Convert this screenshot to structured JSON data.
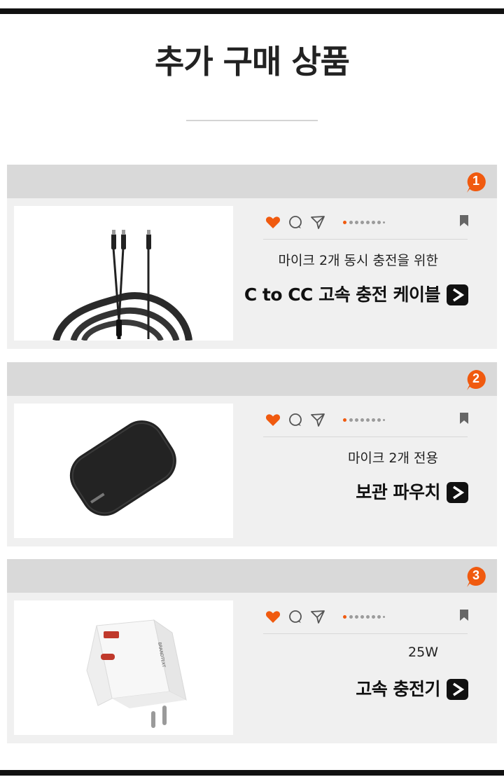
{
  "page": {
    "title": "추가 구매 상품"
  },
  "colors": {
    "accent": "#f05a0f",
    "dark": "#111111",
    "card_bg": "#f0f0f0",
    "header_bg": "#d9d9d9"
  },
  "products": [
    {
      "number": "1",
      "subtitle": "마이크 2개 동시 충전을 위한",
      "name": "C to CC 고속 충전 케이블",
      "go_label": ">",
      "image": "cable-image"
    },
    {
      "number": "2",
      "subtitle": "마이크 2개 전용",
      "name": "보관 파우치",
      "go_label": ">",
      "image": "pouch-image"
    },
    {
      "number": "3",
      "subtitle": "25W",
      "name": "고속 충전기",
      "go_label": ">",
      "image": "charger-image"
    }
  ],
  "icons": {
    "like": "heart-icon",
    "comment": "comment-icon",
    "share": "send-icon",
    "save": "bookmark-icon",
    "pager": "carousel-dots"
  }
}
